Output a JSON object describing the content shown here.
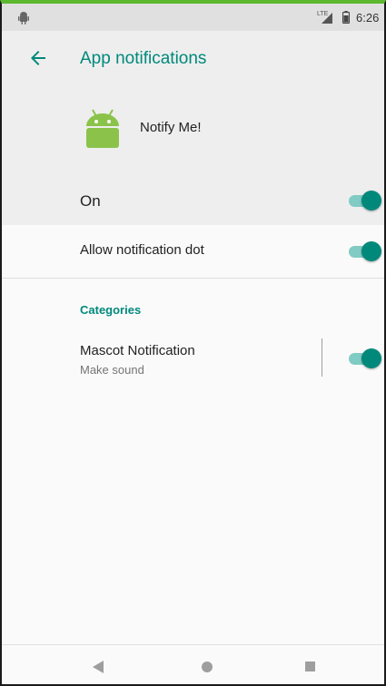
{
  "status_bar": {
    "network": "LTE",
    "time": "6:26",
    "icons": [
      "android-icon",
      "lte-signal-icon",
      "battery-icon"
    ]
  },
  "header": {
    "back_icon": "arrow-back-icon",
    "title": "App notifications"
  },
  "app": {
    "icon": "android-robot-icon",
    "name": "Notify Me!"
  },
  "master_toggle": {
    "label": "On",
    "checked": true
  },
  "settings": {
    "notification_dot": {
      "label": "Allow notification dot",
      "checked": true
    }
  },
  "categories": {
    "header": "Categories",
    "items": [
      {
        "title": "Mascot Notification",
        "summary": "Make sound",
        "checked": true
      }
    ]
  },
  "nav_bar": {
    "icons": [
      "back-triangle-icon",
      "home-circle-icon",
      "recents-square-icon"
    ]
  },
  "colors": {
    "accent": "#00897b",
    "accent_track": "#80cbc4",
    "header_bg": "#eeeeee",
    "status_bar_bg": "#e0e0e0",
    "frame_top": "#5cb82e"
  }
}
